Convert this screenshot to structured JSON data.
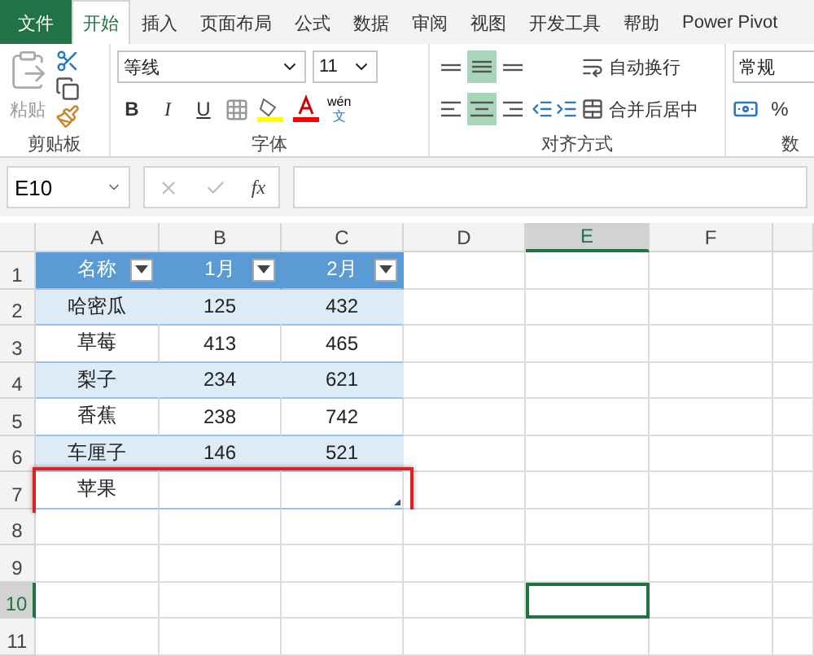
{
  "tabs": [
    {
      "label": "文件",
      "kind": "file",
      "selected": false
    },
    {
      "label": "开始",
      "kind": "tab",
      "selected": true
    },
    {
      "label": "插入",
      "kind": "tab",
      "selected": false
    },
    {
      "label": "页面布局",
      "kind": "tab",
      "selected": false
    },
    {
      "label": "公式",
      "kind": "tab",
      "selected": false
    },
    {
      "label": "数据",
      "kind": "tab",
      "selected": false
    },
    {
      "label": "审阅",
      "kind": "tab",
      "selected": false
    },
    {
      "label": "视图",
      "kind": "tab",
      "selected": false
    },
    {
      "label": "开发工具",
      "kind": "tab",
      "selected": false
    },
    {
      "label": "帮助",
      "kind": "tab",
      "selected": false
    },
    {
      "label": "Power Pivot",
      "kind": "tab",
      "selected": false
    }
  ],
  "ribbon": {
    "clipboard": {
      "paste": "粘贴",
      "label": "剪贴板"
    },
    "font": {
      "name": "等线",
      "size": "11",
      "bold": "B",
      "italic": "I",
      "underline": "U",
      "phonetic_top": "wén",
      "phonetic_bottom": "文",
      "label": "字体"
    },
    "alignment": {
      "vertical": [
        {
          "kind": "top",
          "selected": false
        },
        {
          "kind": "middle",
          "selected": true
        },
        {
          "kind": "bottom",
          "selected": false
        }
      ],
      "horizontal": [
        {
          "kind": "left",
          "selected": false
        },
        {
          "kind": "center",
          "selected": true
        },
        {
          "kind": "right",
          "selected": false
        }
      ],
      "wrap": "自动换行",
      "merge": "合并后居中",
      "label": "对齐方式"
    },
    "number": {
      "format": "常规",
      "percent": "%",
      "label": "数"
    }
  },
  "name_box": "E10",
  "fx": "fx",
  "columns": [
    {
      "label": "A",
      "selected": false
    },
    {
      "label": "B",
      "selected": false
    },
    {
      "label": "C",
      "selected": false
    },
    {
      "label": "D",
      "selected": false
    },
    {
      "label": "E",
      "selected": true
    },
    {
      "label": "F",
      "selected": false
    }
  ],
  "rows": [
    {
      "number": "1",
      "kind": "header",
      "selected": false,
      "cells": [
        "名称",
        "1月",
        "2月"
      ]
    },
    {
      "number": "2",
      "kind": "band",
      "selected": false,
      "cells": [
        "哈密瓜",
        "125",
        "432"
      ]
    },
    {
      "number": "3",
      "kind": "plain",
      "selected": false,
      "cells": [
        "草莓",
        "413",
        "465"
      ]
    },
    {
      "number": "4",
      "kind": "band",
      "selected": false,
      "cells": [
        "梨子",
        "234",
        "621"
      ]
    },
    {
      "number": "5",
      "kind": "plain",
      "selected": false,
      "cells": [
        "香蕉",
        "238",
        "742"
      ]
    },
    {
      "number": "6",
      "kind": "band",
      "selected": false,
      "cells": [
        "车厘子",
        "146",
        "521"
      ]
    },
    {
      "number": "7",
      "kind": "last",
      "selected": false,
      "highlight": true,
      "cells": [
        "苹果",
        "",
        ""
      ]
    },
    {
      "number": "8",
      "kind": "empty",
      "selected": false,
      "cells": []
    },
    {
      "number": "9",
      "kind": "empty",
      "selected": false,
      "cells": []
    },
    {
      "number": "10",
      "kind": "empty",
      "selected": true,
      "cells": []
    },
    {
      "number": "11",
      "kind": "empty",
      "selected": false,
      "cells": []
    }
  ]
}
